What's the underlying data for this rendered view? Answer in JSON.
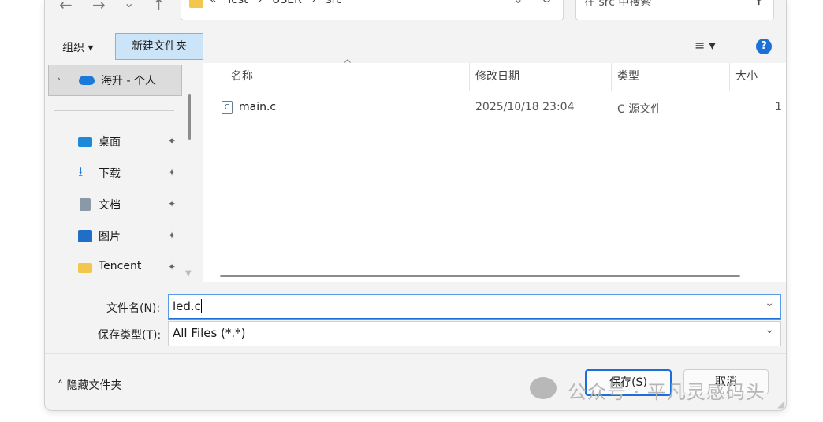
{
  "nav": {
    "back_icon": "←",
    "forward_icon": "→",
    "recent_icon": "⌄",
    "up_icon": "↑",
    "breadcrumbs": [
      "«",
      "Test",
      "›",
      "USER",
      "›",
      "src"
    ],
    "address_dropdown_icon": "⌄",
    "refresh_icon": "↻",
    "search_placeholder": "在 src 中搜索",
    "search_icon": "⚲"
  },
  "toolbar": {
    "organize_label": "组织 ▾",
    "new_folder_label": "新建文件夹",
    "view_menu_label": "≡ ▾",
    "help_label": "?"
  },
  "sidebar": {
    "onedrive": {
      "chevron": "›",
      "label": "海升 - 个人"
    },
    "items": [
      {
        "label": "桌面",
        "icon": "desktop-icon",
        "pin": "✦"
      },
      {
        "label": "下载",
        "icon": "download-icon",
        "pin": "✦"
      },
      {
        "label": "文档",
        "icon": "documents-icon",
        "pin": "✦"
      },
      {
        "label": "图片",
        "icon": "pictures-icon",
        "pin": "✦"
      },
      {
        "label": "Tencent",
        "icon": "folder-icon",
        "pin": "✦"
      }
    ]
  },
  "filelist": {
    "sort_arrow": "^",
    "columns": [
      "名称",
      "修改日期",
      "类型",
      "大小"
    ],
    "rows": [
      {
        "icon_letter": "C",
        "name": "main.c",
        "modified": "2025/10/18 23:04",
        "type": "C 源文件",
        "size": "1"
      }
    ]
  },
  "form": {
    "filename_label": "文件名(N):",
    "filename_value": "led.c",
    "filetype_label": "保存类型(T):",
    "filetype_value": "All Files (*.*)",
    "dropdown_icon": "⌄"
  },
  "footer": {
    "hide_folders_label": "˄ 隐藏文件夹",
    "save_label": "保存(S)",
    "cancel_label": "取消"
  },
  "watermark": {
    "text": "公众号 · 平凡灵感码头"
  }
}
